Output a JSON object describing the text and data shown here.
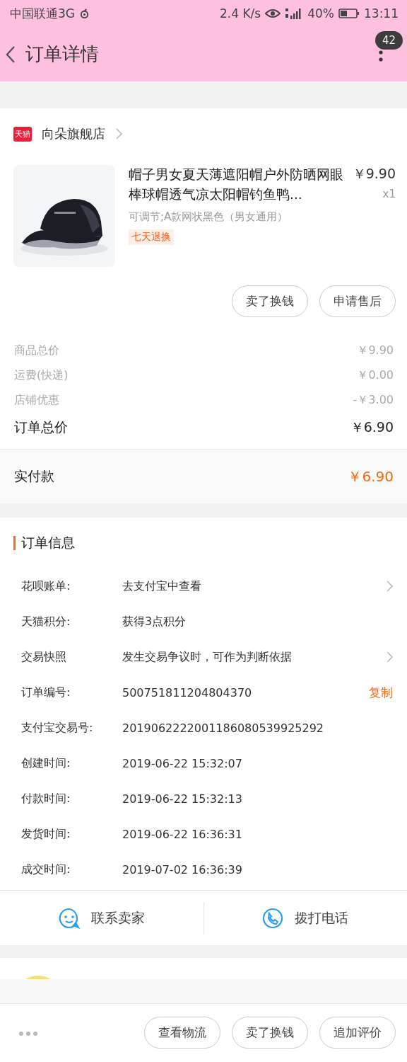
{
  "status_bar": {
    "carrier": "中国联通3G",
    "speed": "2.4 K/s",
    "battery": "40%",
    "time": "13:11"
  },
  "header": {
    "title": "订单详情",
    "badge": "42"
  },
  "store": {
    "badge": "天猫",
    "name": "向朵旗舰店"
  },
  "product": {
    "title": "帽子男女夏天薄遮阳帽户外防晒网眼棒球帽透气凉太阳帽钓鱼鸭...",
    "price": "￥9.90",
    "quantity": "x1",
    "sku": "可调节;A款网状黑色（男女通用）",
    "tag": "七天退换"
  },
  "item_buttons": [
    "卖了换钱",
    "申请售后"
  ],
  "summary": [
    {
      "label": "商品总价",
      "value": "￥9.90",
      "kind": "sub"
    },
    {
      "label": "运费(快递)",
      "value": "￥0.00",
      "kind": "sub"
    },
    {
      "label": "店铺优惠",
      "value": "-￥3.00",
      "kind": "sub"
    },
    {
      "label": "订单总价",
      "value": "￥6.90",
      "kind": "total"
    }
  ],
  "paid": {
    "label": "实付款",
    "value": "￥6.90"
  },
  "order_info": {
    "title": "订单信息",
    "rows": [
      {
        "label": "花呗账单:",
        "value": "去支付宝中查看",
        "kind": "link"
      },
      {
        "label": "天猫积分:",
        "value": "获得3点积分",
        "kind": "plain"
      },
      {
        "label": "交易快照",
        "value": "发生交易争议时，可作为判断依据",
        "kind": "link"
      },
      {
        "label": "订单编号:",
        "value": "500751811204804370",
        "kind": "copy",
        "action": "复制"
      },
      {
        "label": "支付宝交易号:",
        "value": "2019062222001186080539925292",
        "kind": "plain"
      },
      {
        "label": "创建时间:",
        "value": "2019-06-22 15:32:07",
        "kind": "plain"
      },
      {
        "label": "付款时间:",
        "value": "2019-06-22 15:32:13",
        "kind": "plain"
      },
      {
        "label": "发货时间:",
        "value": "2019-06-22 16:36:31",
        "kind": "plain"
      },
      {
        "label": "成交时间:",
        "value": "2019-07-02 16:36:39",
        "kind": "plain"
      }
    ]
  },
  "contact": [
    {
      "label": "联系卖家",
      "kind": "chat"
    },
    {
      "label": "拨打电话",
      "kind": "phone"
    }
  ],
  "bottom_buttons": [
    "查看物流",
    "卖了换钱",
    "追加评价"
  ]
}
